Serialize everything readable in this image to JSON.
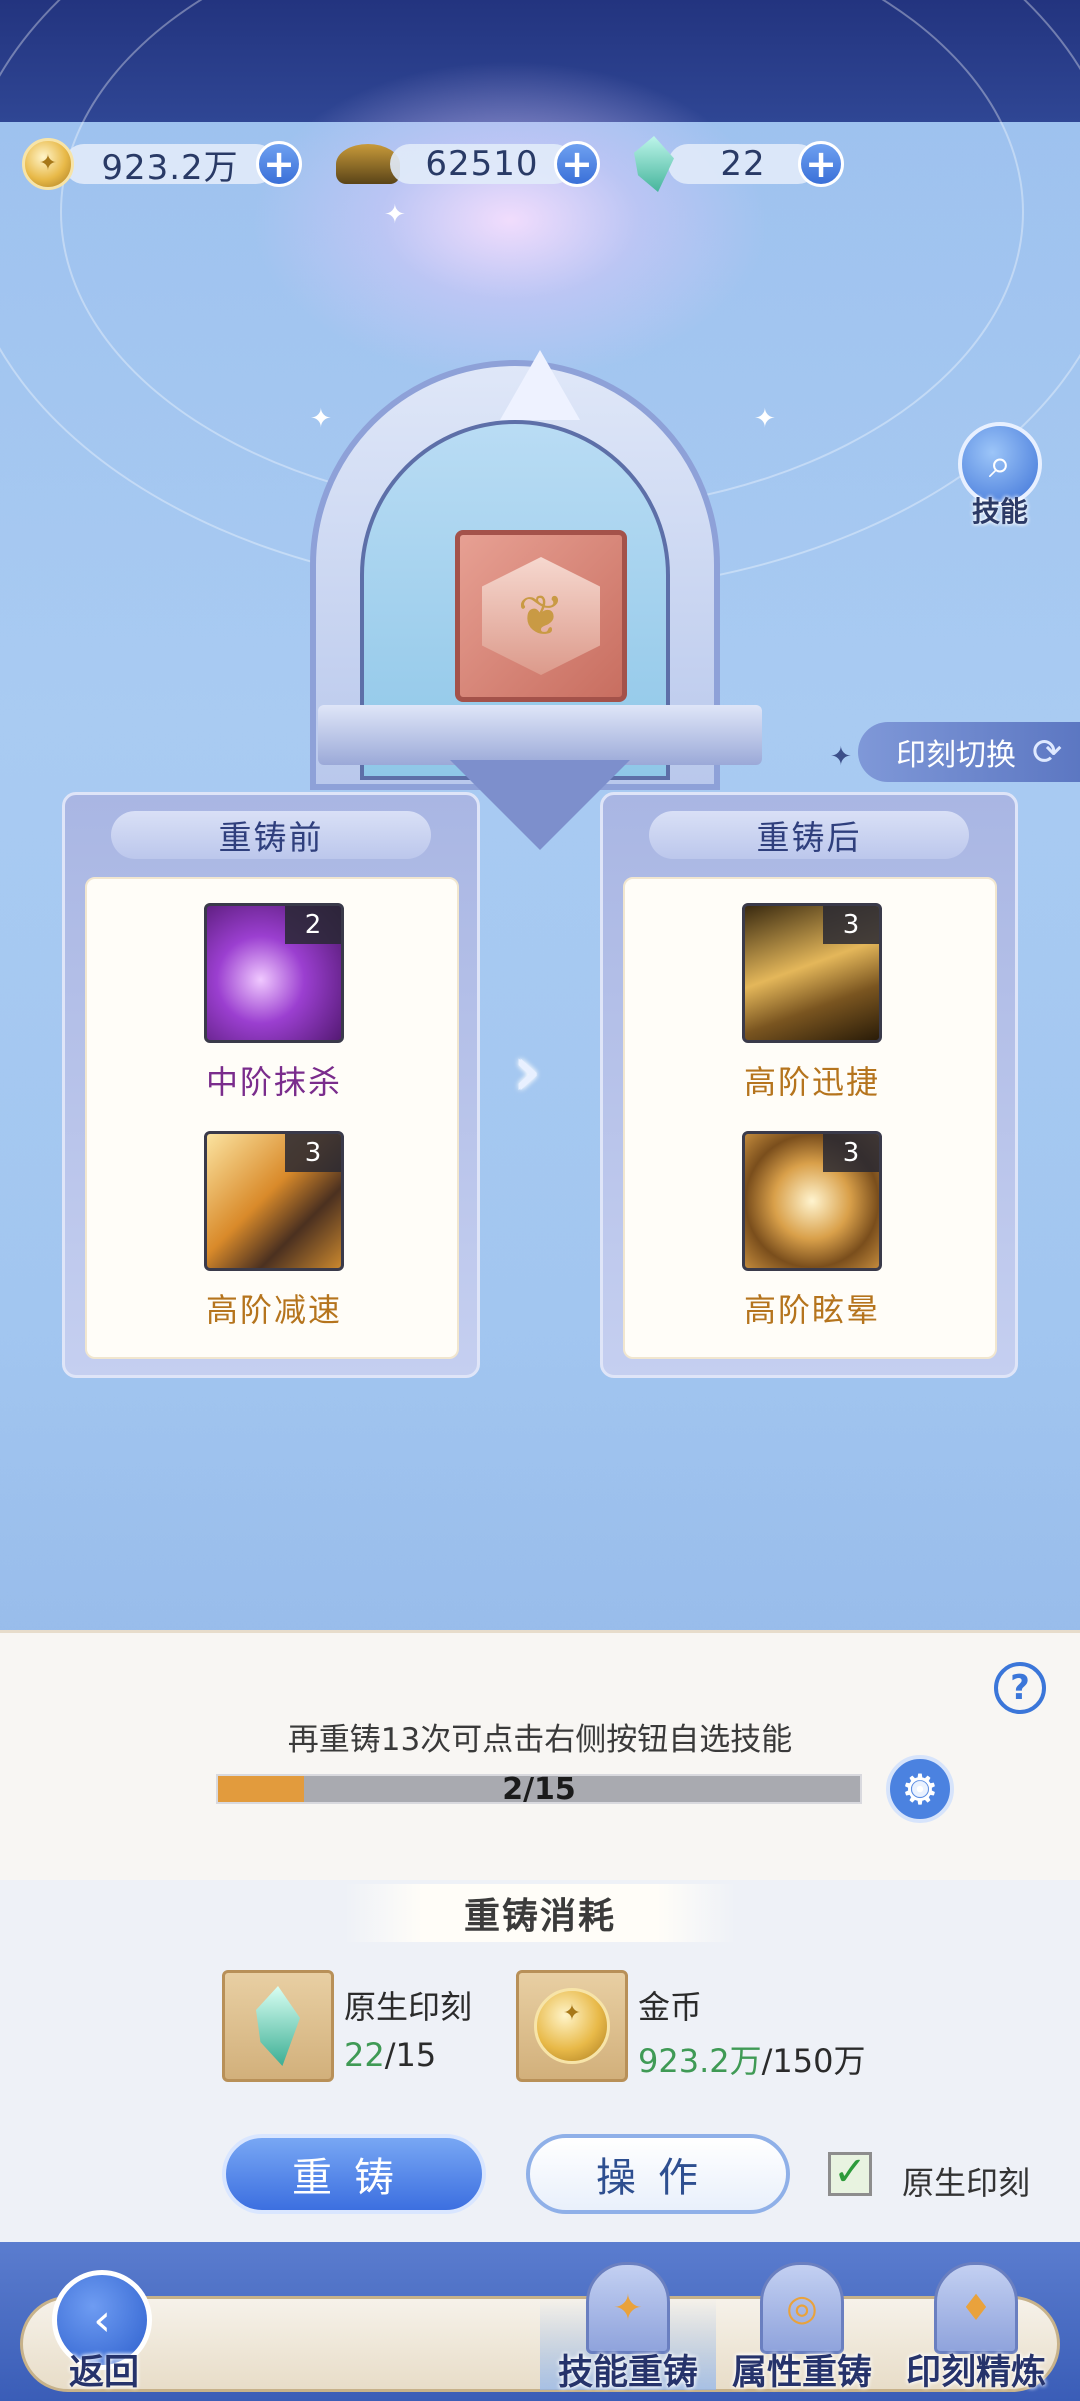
{
  "currency": [
    {
      "icon": "gold-coin-icon",
      "value": "923.2万"
    },
    {
      "icon": "ore-icon",
      "value": "62510"
    },
    {
      "icon": "crystal-icon",
      "value": "22"
    }
  ],
  "side": {
    "skill_label": "技能",
    "switch_label": "印刻切换"
  },
  "compare": {
    "before": {
      "title": "重铸前",
      "skills": [
        {
          "name": "中阶抹杀",
          "level": "2",
          "color": "#7a2c8c"
        },
        {
          "name": "高阶减速",
          "level": "3",
          "color": "#b5741d"
        }
      ]
    },
    "after": {
      "title": "重铸后",
      "skills": [
        {
          "name": "高阶迅捷",
          "level": "3",
          "color": "#b5741d"
        },
        {
          "name": "高阶眩晕",
          "level": "3",
          "color": "#b5741d"
        }
      ]
    }
  },
  "progress": {
    "hint": "再重铸13次可点击右侧按钮自选技能",
    "text": "2/15",
    "fraction": 0.1333
  },
  "cost": {
    "title": "重铸消耗",
    "items": [
      {
        "icon": "crystal-icon",
        "name": "原生印刻",
        "have": "22",
        "need": "/15"
      },
      {
        "icon": "gold-coin-icon",
        "name": "金币",
        "have": "923.2万",
        "need": "/150万"
      }
    ]
  },
  "actions": {
    "reforge": "重铸",
    "operate": "操作",
    "checkbox_label": "原生印刻",
    "checked": true
  },
  "tabs": {
    "back": "返回",
    "items": [
      "技能重铸",
      "属性重铸",
      "印刻精炼"
    ],
    "active": 0
  },
  "colors": {
    "accent": "#3c6fe0",
    "progress": "#e29b3d",
    "have_ok": "#3f9a55"
  }
}
